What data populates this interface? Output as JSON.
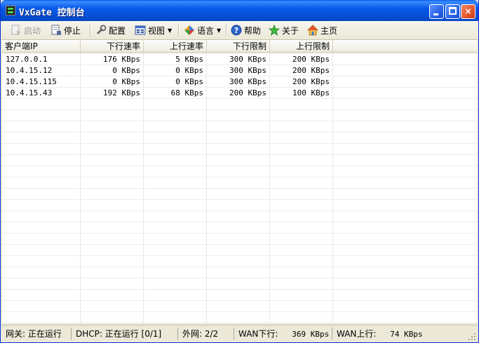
{
  "window": {
    "title": "VxGate 控制台",
    "controls": {
      "minimize": "minimize",
      "maximize": "maximize",
      "close": "×"
    }
  },
  "toolbar": {
    "start_label": "启动",
    "stop_label": "停止",
    "config_label": "配置",
    "view_label": "视图",
    "language_label": "语言",
    "help_label": "帮助",
    "about_label": "关于",
    "home_label": "主页"
  },
  "table": {
    "columns": [
      "客户端IP",
      "下行速率",
      "上行速率",
      "下行限制",
      "上行限制"
    ],
    "rows": [
      [
        "127.0.0.1",
        "176 KBps",
        "5 KBps",
        "300 KBps",
        "200 KBps"
      ],
      [
        "10.4.15.12",
        "0 KBps",
        "0 KBps",
        "300 KBps",
        "200 KBps"
      ],
      [
        "10.4.15.115",
        "0 KBps",
        "0 KBps",
        "300 KBps",
        "200 KBps"
      ],
      [
        "10.4.15.43",
        "192 KBps",
        "68 KBps",
        "200 KBps",
        "100 KBps"
      ]
    ]
  },
  "status": {
    "gateway": "网关: 正在运行",
    "dhcp": "DHCP: 正在运行 [0/1]",
    "wan": "外网: 2/2",
    "wan_down_label": "WAN下行:",
    "wan_down_value": "369 KBps",
    "wan_up_label": "WAN上行:",
    "wan_up_value": "74 KBps"
  },
  "colors": {
    "titlebar": "#0858e8",
    "face": "#ece9d8",
    "close_button": "#e3572c"
  }
}
